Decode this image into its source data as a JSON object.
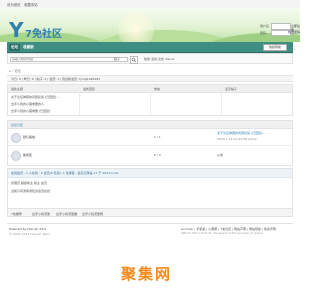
{
  "topbar": {
    "left": "设为首页",
    "right": "收藏本站"
  },
  "logo": {
    "mark": "Y",
    "text": "7免社区"
  },
  "login": {
    "username_label": "用户名",
    "password_label": "密码",
    "register_link": "立即注册",
    "find_password_link": "找回密码"
  },
  "nav": {
    "items": [
      "论坛",
      "收藏版"
    ],
    "quick_nav": "快捷导航"
  },
  "search": {
    "placeholder": "请输入搜索内容",
    "scope": "帖子",
    "hot_label": "热搜",
    "hot_items": [
      "活动",
      "交友",
      "discuz"
    ]
  },
  "breadcrumb": "论坛",
  "stats": "今日: 0 | 昨日: 0 | 帖子: 2 | 会员: 1 | 欢迎新会员: tyrsg1045281",
  "table": {
    "headers": [
      "最新主题",
      "最新回复",
      "热帖",
      "爱乎帖子"
    ],
    "rows": [
      "关于论坛弹幕的问题反馈 [已回复] ...",
      "出手小钱的心理重要的人",
      "出手小钱的心理重要 [已回复]"
    ]
  },
  "section": {
    "title": "论坛分区",
    "forums": [
      {
        "name": "默认版块",
        "count": "1 / 1",
        "last": "关于论坛弹幕的问题反馈 [已回复]...",
        "date": "2024-1-16 01:43:56 admin"
      },
      {
        "name": "版务区",
        "count": "0 / 0",
        "last": "从未"
      }
    ]
  },
  "online": {
    "title": "在线会员 - 1 人在线 - 0 会员(0 隐身), 1 位游客 - 最高记录是 17 于 2024-1-16.",
    "legend": [
      "管理员",
      "超级版主",
      "版主",
      "会员"
    ],
    "line2": "当前只有游客或隐身会员在线"
  },
  "friend_links": {
    "label": "7免推荐",
    "items": [
      "出手小钱流量",
      "出手小钱流量赚",
      "出手小钱流量网"
    ]
  },
  "footer": {
    "powered": "Powered by Discuz! X3.5",
    "copyright": "© 2001-2024 Discuz! Team.",
    "links": "Archiver | 手机版 | 小黑屋 | 7免社区 | 网站声明 | 网站导航 | 免责声明",
    "time": "GMT+8, 2024-1-16 01:43 , Processed in 0.017 second(s), 17 queries ."
  },
  "watermark": "聚集网"
}
